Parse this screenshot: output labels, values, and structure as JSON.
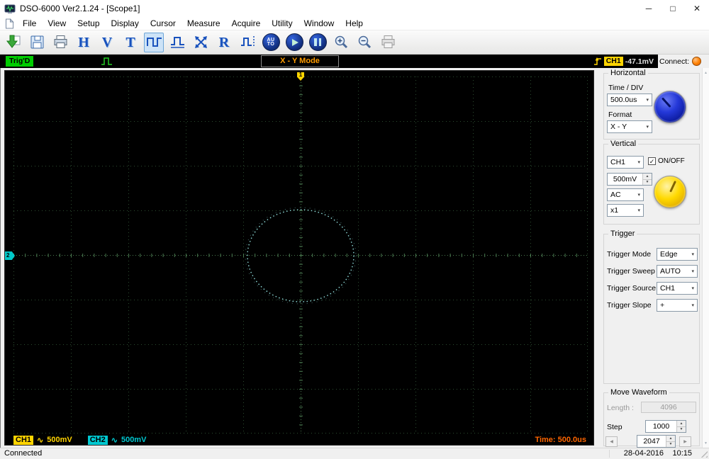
{
  "window": {
    "title": "DSO-6000 Ver2.1.24 - [Scope1]",
    "controls": {
      "minimize": "─",
      "maximize": "□",
      "close": "✕"
    }
  },
  "menu": {
    "items": [
      "File",
      "View",
      "Setup",
      "Display",
      "Cursor",
      "Measure",
      "Acquire",
      "Utility",
      "Window",
      "Help"
    ]
  },
  "toolbar": {
    "letters": {
      "h": "H",
      "v": "V",
      "t": "T",
      "r": "R"
    },
    "auto_label": "AUTO",
    "icons": [
      "load-waveform",
      "save",
      "print",
      "horizontal-settings",
      "vertical-settings",
      "trigger-settings",
      "waveform-display",
      "waveform-baseline",
      "autoscale",
      "record",
      "waveform-cursor",
      "auto-setup",
      "run",
      "pause",
      "zoom-in",
      "zoom-out",
      "print-preview"
    ]
  },
  "trig_strip": {
    "status": "Trig'D",
    "mode": "X - Y Mode",
    "readout_channel": "CH1",
    "readout_value": "-47.1mV"
  },
  "scope": {
    "top_marker": "1",
    "left_marker": "2",
    "ch1": {
      "name": "CH1",
      "coupling": "∿",
      "scale": "500mV"
    },
    "ch2": {
      "name": "CH2",
      "coupling": "∿",
      "scale": "500mV"
    },
    "time_readout": "Time: 500.0us",
    "grid": {
      "cols": 10,
      "rows": 8
    },
    "waveform": {
      "type": "xy-lissajous-ellipse",
      "center_div": [
        0,
        0
      ],
      "rx_div": 0.93,
      "ry_div": 1.03,
      "color": "#8fdcda"
    }
  },
  "panel": {
    "connect": {
      "label": "Connect:"
    },
    "horizontal": {
      "title": "Horizontal",
      "time_div_label": "Time / DIV",
      "time_div_value": "500.0us",
      "format_label": "Format",
      "format_value": "X - Y"
    },
    "vertical": {
      "title": "Vertical",
      "channel": "CH1",
      "onoff_label": "ON/OFF",
      "onoff_checked": true,
      "scale": "500mV",
      "coupling": "AC",
      "probe": "x1"
    },
    "trigger": {
      "title": "Trigger",
      "rows": [
        {
          "label": "Trigger Mode",
          "value": "Edge"
        },
        {
          "label": "Trigger Sweep",
          "value": "AUTO"
        },
        {
          "label": "Trigger Source",
          "value": "CH1"
        },
        {
          "label": "Trigger Slope",
          "value": "+"
        }
      ]
    },
    "move_waveform": {
      "title": "Move Waveform",
      "length_label": "Length :",
      "length_value": "4096",
      "step_label": "Step",
      "step_value": "1000",
      "position_value": "2047"
    }
  },
  "statusbar": {
    "status": "Connected",
    "date": "28-04-2016",
    "time": "10:15"
  },
  "ui": {
    "dropdown_arrow": "▾",
    "spin_up": "▲",
    "spin_down": "▼",
    "left_arrow": "◀",
    "right_arrow": "▶",
    "scroll_up": "▲",
    "scroll_down": "▼",
    "check_glyph": "✓"
  },
  "colors": {
    "ch1": "#ffd400",
    "ch2": "#00c8d0",
    "time": "#ff6600",
    "trig_status_bg": "#00cc00",
    "mode_text": "#ff9c00",
    "connect_indicator": "#ff8000"
  }
}
